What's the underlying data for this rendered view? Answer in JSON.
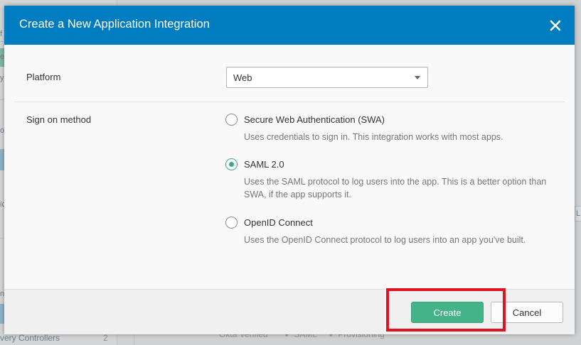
{
  "background": {
    "sidebar_frags": [
      "f",
      "e",
      "yc",
      "op",
      "ic",
      "n"
    ],
    "sidebar_link": "very Controllers",
    "sidebar_count": "2",
    "row_tags": [
      "Okta Verified",
      "✔ SAML",
      "✔ Provisioning"
    ],
    "right_frag": "L"
  },
  "modal": {
    "title": "Create a New Application Integration",
    "close_icon": "close-icon",
    "platform": {
      "label": "Platform",
      "selected": "Web"
    },
    "sign_on": {
      "label": "Sign on method",
      "options": [
        {
          "label": "Secure Web Authentication (SWA)",
          "description": "Uses credentials to sign in. This integration works with most apps.",
          "checked": false
        },
        {
          "label": "SAML 2.0",
          "description": "Uses the SAML protocol to log users into the app. This is a better option than SWA, if the app supports it.",
          "checked": true
        },
        {
          "label": "OpenID Connect",
          "description": "Uses the OpenID Connect protocol to log users into an app you've built.",
          "checked": false
        }
      ]
    },
    "footer": {
      "create_label": "Create",
      "cancel_label": "Cancel"
    }
  },
  "colors": {
    "header": "#007dc1",
    "primary_button": "#44b38a",
    "radio_checked": "#3fa58a",
    "highlight": "#e0141e"
  }
}
